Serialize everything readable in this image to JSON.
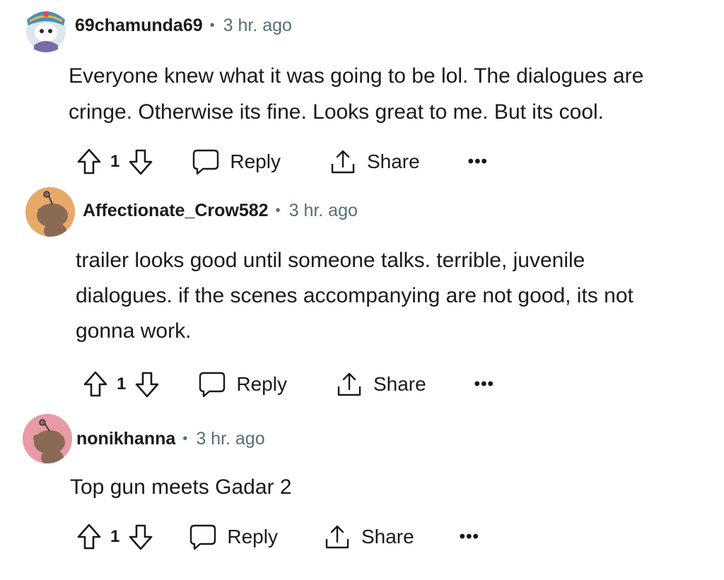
{
  "comments": [
    {
      "author": "69chamunda69",
      "separator": "•",
      "time": "3 hr. ago",
      "lines": [
        "Everyone knew what it was going to be lol. The dialogues are",
        "cringe. Otherwise its fine. Looks great to me. But its cool."
      ],
      "votes": "1",
      "reply_label": "Reply",
      "share_label": "Share",
      "more_label": "•••"
    },
    {
      "author": "Affectionate_Crow582",
      "separator": "•",
      "time": "3 hr. ago",
      "lines": [
        "trailer looks good until someone talks. terrible, juvenile",
        "dialogues. if the scenes accompanying are not good, its not",
        "gonna work."
      ],
      "votes": "1",
      "reply_label": "Reply",
      "share_label": "Share",
      "more_label": "•••"
    },
    {
      "author": "nonikhanna",
      "separator": "•",
      "time": "3 hr. ago",
      "lines": [
        "Top gun meets Gadar 2"
      ],
      "votes": "1",
      "reply_label": "Reply",
      "share_label": "Share",
      "more_label": "•••"
    }
  ],
  "colors": {
    "text": "#1a1a1b",
    "meta": "#576f76",
    "avatar_orange": "#e8a86a",
    "avatar_pink": "#e89aa6",
    "snoo_brown": "#8a6a55"
  },
  "icons": [
    "upvote-icon",
    "downvote-icon",
    "comment-bubble-icon",
    "share-icon",
    "more-options-icon"
  ]
}
